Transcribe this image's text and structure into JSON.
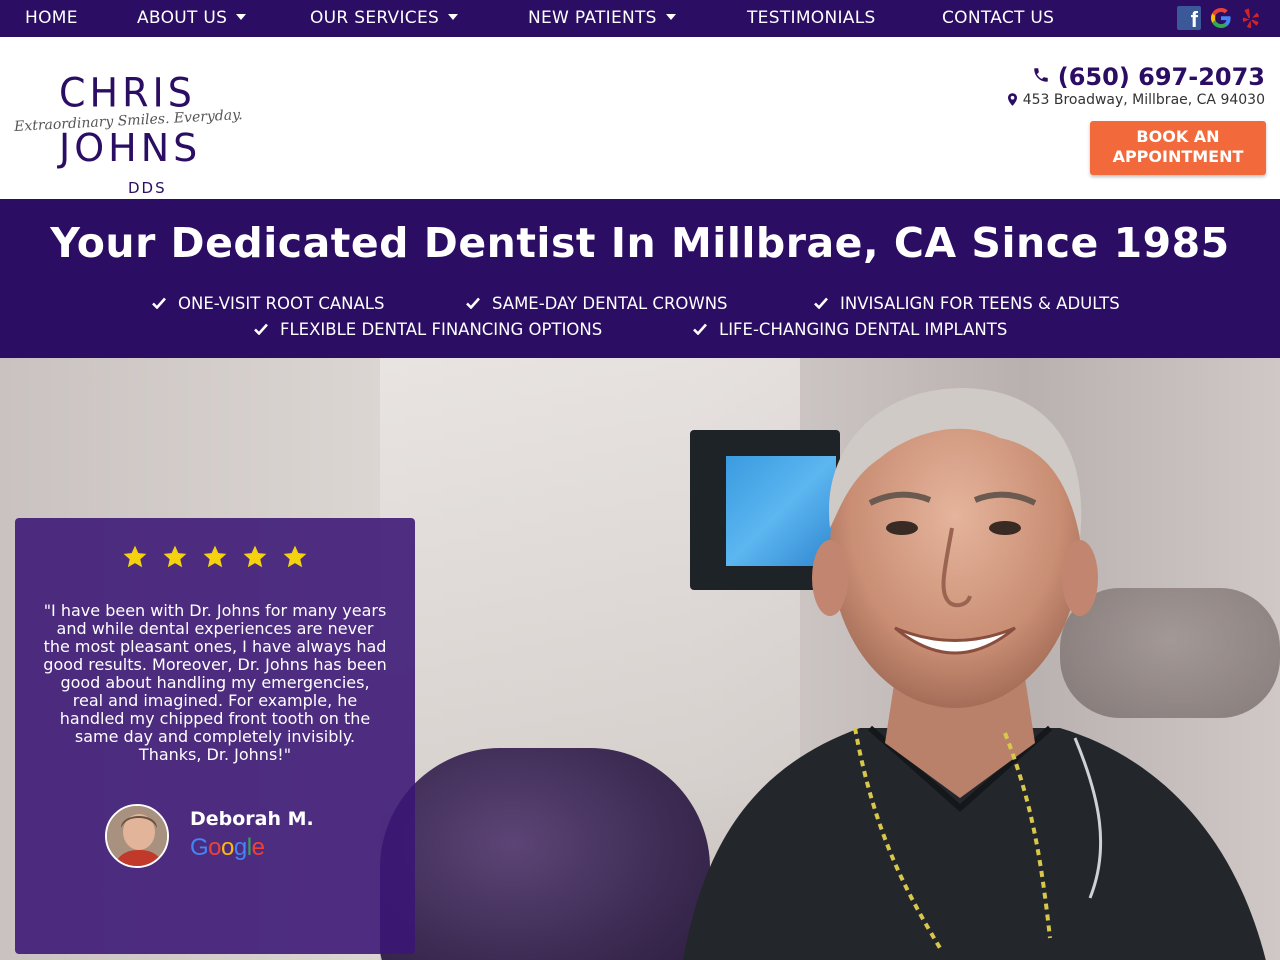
{
  "nav": {
    "items": [
      {
        "label": "HOME"
      },
      {
        "label": "ABOUT US"
      },
      {
        "label": "OUR SERVICES"
      },
      {
        "label": "NEW PATIENTS"
      },
      {
        "label": "TESTIMONIALS"
      },
      {
        "label": "CONTACT US"
      }
    ],
    "social": [
      "facebook-icon",
      "google-icon",
      "yelp-icon"
    ]
  },
  "logo": {
    "line1": "CHRIS",
    "tagline": "Extraordinary Smiles. Everyday.",
    "line2": "JOHNS",
    "suffix": "DDS"
  },
  "contact": {
    "phone": "(650) 697-2073",
    "address": "453 Broadway, Millbrae, CA 94030",
    "cta_line1": "BOOK AN",
    "cta_line2": "APPOINTMENT"
  },
  "banner": {
    "title": "Your Dedicated Dentist In Millbrae, CA Since 1985",
    "features": [
      "ONE-VISIT ROOT CANALS",
      "SAME-DAY DENTAL CROWNS",
      "INVISALIGN FOR TEENS & ADULTS",
      "FLEXIBLE DENTAL FINANCING OPTIONS",
      "LIFE-CHANGING DENTAL IMPLANTS"
    ]
  },
  "review": {
    "rating": 5,
    "quote": "\"I have been with Dr. Johns for many years and while dental experiences are never the most pleasant ones, I have always had good results. Moreover, Dr. Johns has been good about handling my emergencies, real and imagined. For example, he handled my chipped front tooth on the same day and completely invisibly. Thanks, Dr. Johns!\"",
    "reviewer": "Deborah M.",
    "source": "Google"
  },
  "colors": {
    "brand_purple": "#2b0d63",
    "cta_orange": "#f26a3b",
    "star_yellow": "#f5d20f"
  }
}
